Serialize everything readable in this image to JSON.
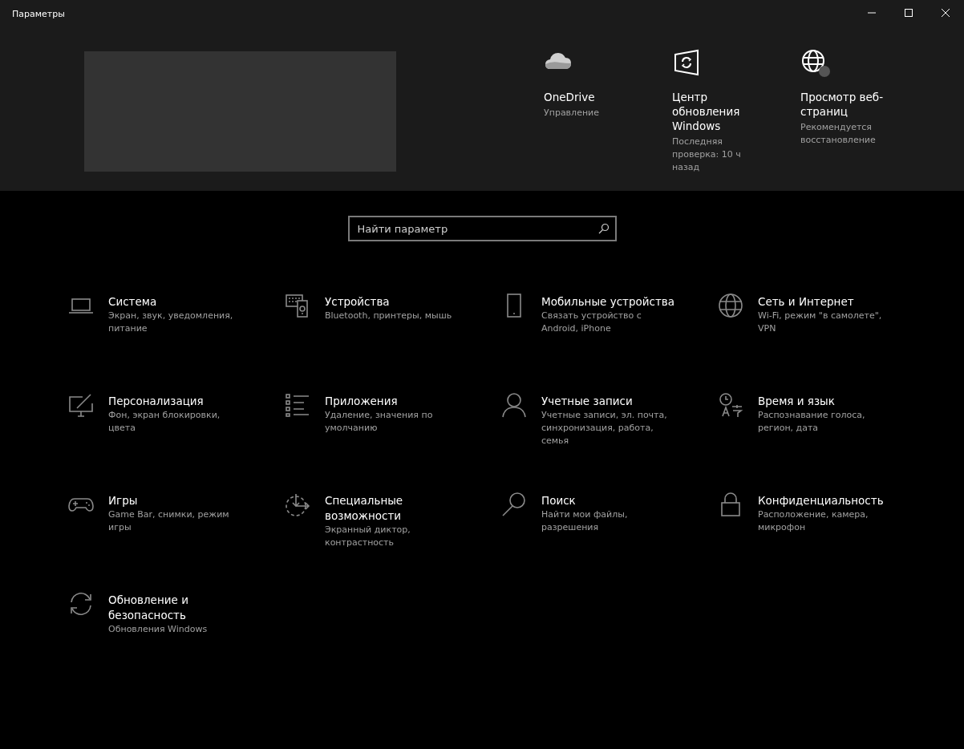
{
  "window": {
    "title": "Параметры"
  },
  "header": {
    "items": [
      {
        "title": "OneDrive",
        "subtitle": "Управление"
      },
      {
        "title": "Центр обновления Windows",
        "subtitle": "Последняя проверка: 10 ч назад"
      },
      {
        "title": "Просмотр веб-страниц",
        "subtitle": "Рекомендуется восстановление"
      }
    ]
  },
  "search": {
    "placeholder": "Найти параметр"
  },
  "categories": [
    {
      "title": "Система",
      "subtitle": "Экран, звук, уведомления, питание"
    },
    {
      "title": "Устройства",
      "subtitle": "Bluetooth, принтеры, мышь"
    },
    {
      "title": "Мобильные устройства",
      "subtitle": "Связать устройство с Android, iPhone"
    },
    {
      "title": "Сеть и Интернет",
      "subtitle": "Wi-Fi, режим \"в самолете\", VPN"
    },
    {
      "title": "Персонализация",
      "subtitle": "Фон, экран блокировки, цвета"
    },
    {
      "title": "Приложения",
      "subtitle": "Удаление, значения по умолчанию"
    },
    {
      "title": "Учетные записи",
      "subtitle": "Учетные записи, эл. почта, синхронизация, работа, семья"
    },
    {
      "title": "Время и язык",
      "subtitle": "Распознавание голоса, регион, дата"
    },
    {
      "title": "Игры",
      "subtitle": "Game Bar, снимки, режим игры"
    },
    {
      "title": "Специальные возможности",
      "subtitle": "Экранный диктор, контрастность"
    },
    {
      "title": "Поиск",
      "subtitle": "Найти мои файлы, разрешения"
    },
    {
      "title": "Конфиденциальность",
      "subtitle": "Расположение, камера, микрофон"
    },
    {
      "title": "Обновление и безопасность",
      "subtitle": "Обновления Windows"
    }
  ]
}
